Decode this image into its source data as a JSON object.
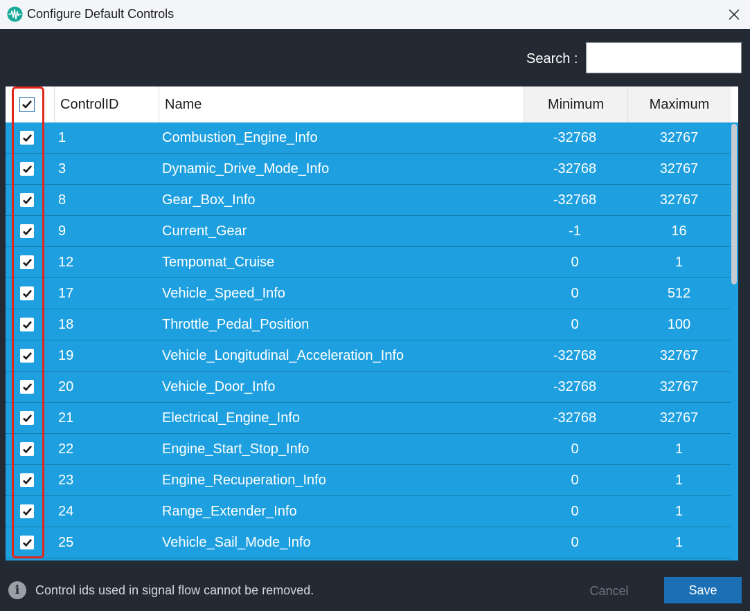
{
  "window": {
    "title": "Configure Default Controls",
    "app_icon": "waveform-icon",
    "close_icon": "close-icon"
  },
  "search": {
    "label": "Search :",
    "value": "",
    "placeholder": ""
  },
  "table": {
    "headers": {
      "select_all_checked": true,
      "control_id": "ControlID",
      "name": "Name",
      "minimum": "Minimum",
      "maximum": "Maximum"
    },
    "rows": [
      {
        "checked": true,
        "id": "1",
        "name": "Combustion_Engine_Info",
        "min": "-32768",
        "max": "32767"
      },
      {
        "checked": true,
        "id": "3",
        "name": "Dynamic_Drive_Mode_Info",
        "min": "-32768",
        "max": "32767"
      },
      {
        "checked": true,
        "id": "8",
        "name": "Gear_Box_Info",
        "min": "-32768",
        "max": "32767"
      },
      {
        "checked": true,
        "id": "9",
        "name": "Current_Gear",
        "min": "-1",
        "max": "16"
      },
      {
        "checked": true,
        "id": "12",
        "name": "Tempomat_Cruise",
        "min": "0",
        "max": "1"
      },
      {
        "checked": true,
        "id": "17",
        "name": "Vehicle_Speed_Info",
        "min": "0",
        "max": "512"
      },
      {
        "checked": true,
        "id": "18",
        "name": "Throttle_Pedal_Position",
        "min": "0",
        "max": "100"
      },
      {
        "checked": true,
        "id": "19",
        "name": "Vehicle_Longitudinal_Acceleration_Info",
        "min": "-32768",
        "max": "32767"
      },
      {
        "checked": true,
        "id": "20",
        "name": "Vehicle_Door_Info",
        "min": "-32768",
        "max": "32767"
      },
      {
        "checked": true,
        "id": "21",
        "name": "Electrical_Engine_Info",
        "min": "-32768",
        "max": "32767"
      },
      {
        "checked": true,
        "id": "22",
        "name": "Engine_Start_Stop_Info",
        "min": "0",
        "max": "1"
      },
      {
        "checked": true,
        "id": "23",
        "name": "Engine_Recuperation_Info",
        "min": "0",
        "max": "1"
      },
      {
        "checked": true,
        "id": "24",
        "name": "Range_Extender_Info",
        "min": "0",
        "max": "1"
      },
      {
        "checked": true,
        "id": "25",
        "name": "Vehicle_Sail_Mode_Info",
        "min": "0",
        "max": "1"
      }
    ]
  },
  "footer": {
    "info_icon": "info-icon",
    "info_text": "Control ids used in signal flow cannot be removed.",
    "cancel_label": "Cancel",
    "save_label": "Save"
  },
  "colors": {
    "row_background": "#1ea0e0",
    "dialog_background": "#232a33",
    "save_button": "#1a6fb5",
    "highlight_border": "#e1261c"
  }
}
